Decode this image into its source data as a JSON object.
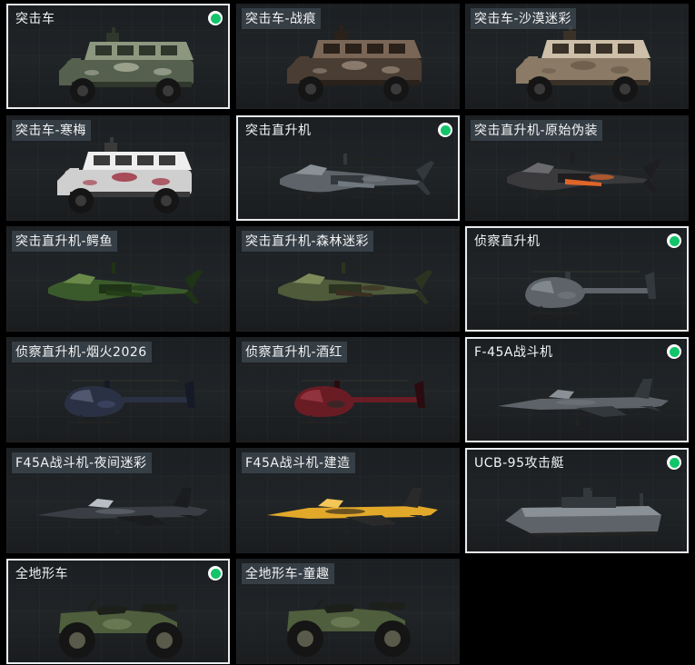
{
  "vehicles": [
    {
      "label": "突击车",
      "selected": true,
      "kind": "truck",
      "scheme": "green"
    },
    {
      "label": "突击车-战痕",
      "selected": false,
      "kind": "truck",
      "scheme": "scarred"
    },
    {
      "label": "突击车-沙漠迷彩",
      "selected": false,
      "kind": "truck",
      "scheme": "desert"
    },
    {
      "label": "突击车-寒梅",
      "selected": false,
      "kind": "truck",
      "scheme": "plum"
    },
    {
      "label": "突击直升机",
      "selected": true,
      "kind": "apache",
      "scheme": "gray"
    },
    {
      "label": "突击直升机-原始伪装",
      "selected": false,
      "kind": "apache",
      "scheme": "orange"
    },
    {
      "label": "突击直升机-鳄鱼",
      "selected": false,
      "kind": "apache",
      "scheme": "croc"
    },
    {
      "label": "突击直升机-森林迷彩",
      "selected": false,
      "kind": "apache",
      "scheme": "forest"
    },
    {
      "label": "侦察直升机",
      "selected": true,
      "kind": "scout",
      "scheme": "gray"
    },
    {
      "label": "侦察直升机-烟火2026",
      "selected": false,
      "kind": "scout",
      "scheme": "navy"
    },
    {
      "label": "侦察直升机-酒红",
      "selected": false,
      "kind": "scout",
      "scheme": "wine"
    },
    {
      "label": "F-45A战斗机",
      "selected": true,
      "kind": "jet",
      "scheme": "gray"
    },
    {
      "label": "F45A战斗机-夜间迷彩",
      "selected": false,
      "kind": "jet",
      "scheme": "night"
    },
    {
      "label": "F45A战斗机-建造",
      "selected": false,
      "kind": "jet",
      "scheme": "yellow"
    },
    {
      "label": "UCB-95攻击艇",
      "selected": true,
      "kind": "boat",
      "scheme": "gray"
    },
    {
      "label": "全地形车",
      "selected": true,
      "kind": "atv",
      "scheme": "olive"
    },
    {
      "label": "全地形车-童趣",
      "selected": false,
      "kind": "atv",
      "scheme": "olive"
    }
  ],
  "colors": {
    "selected_border": "#e8ecef",
    "badge_green": "#12c46a",
    "card_bg": "#1f2326",
    "label_bg": "#4a5862"
  }
}
